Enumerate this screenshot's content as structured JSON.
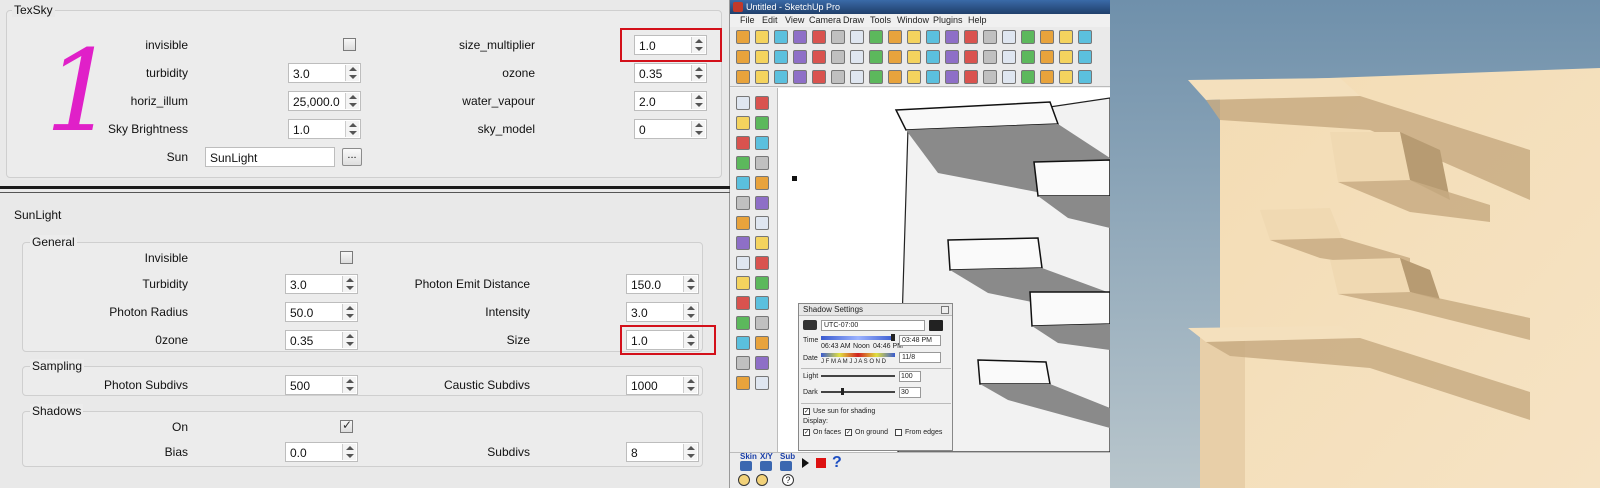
{
  "texsky": {
    "title": "TexSky",
    "big_number": "1",
    "invisible_label": "invisible",
    "turbidity_label": "turbidity",
    "turbidity_value": "3.0",
    "horiz_illum_label": "horiz_illum",
    "horiz_illum_value": "25,000.0",
    "sky_brightness_label": "Sky Brightness",
    "sky_brightness_value": "1.0",
    "sun_label": "Sun",
    "sun_value": "SunLight",
    "browse_label": "...",
    "size_multiplier_label": "size_multiplier",
    "size_multiplier_value": "1.0",
    "ozone_label": "ozone",
    "ozone_value": "0.35",
    "water_vapour_label": "water_vapour",
    "water_vapour_value": "2.0",
    "sky_model_label": "sky_model",
    "sky_model_value": "0",
    "highlight_color": "#d3101a",
    "number_color": "#e020c8"
  },
  "sunlight": {
    "title": "SunLight",
    "general_title": "General",
    "invisible_label": "Invisible",
    "turbidity_label": "Turbidity",
    "turbidity_value": "3.0",
    "photon_radius_label": "Photon Radius",
    "photon_radius_value": "50.0",
    "ozone_label": "0zone",
    "ozone_value": "0.35",
    "photon_emit_distance_label": "Photon Emit Distance",
    "photon_emit_distance_value": "150.0",
    "intensity_label": "Intensity",
    "intensity_value": "3.0",
    "size_label": "Size",
    "size_value": "1.0",
    "sampling_title": "Sampling",
    "photon_subdivs_label": "Photon Subdivs",
    "photon_subdivs_value": "500",
    "caustic_subdivs_label": "Caustic Subdivs",
    "caustic_subdivs_value": "1000",
    "shadows_title": "Shadows",
    "on_label": "On",
    "on_checked": true,
    "bias_label": "Bias",
    "bias_value": "0.0",
    "subdivs_label": "Subdivs",
    "subdivs_value": "8"
  },
  "sketchup": {
    "window_title": "Untitled - SketchUp Pro",
    "menus": [
      "File",
      "Edit",
      "View",
      "Camera",
      "Draw",
      "Tools",
      "Window",
      "Plugins",
      "Help"
    ],
    "shadow_settings": {
      "title": "Shadow Settings",
      "timezone": "UTC-07:00",
      "time_label": "Time",
      "time_start": "06:43 AM",
      "time_noon": "Noon",
      "time_end": "04:46 PM",
      "time_value": "03:48 PM",
      "date_label": "Date",
      "months": "J F M A M J J A S O N D",
      "date_value": "11/8",
      "light_label": "Light",
      "light_value": "100",
      "dark_label": "Dark",
      "dark_value": "30",
      "use_sun_label": "Use sun for shading",
      "display_label": "Display:",
      "on_faces_label": "On faces",
      "on_ground_label": "On ground",
      "from_edges_label": "From edges"
    },
    "bottom_labels": [
      "Skin",
      "X/Y",
      "Sub"
    ]
  }
}
